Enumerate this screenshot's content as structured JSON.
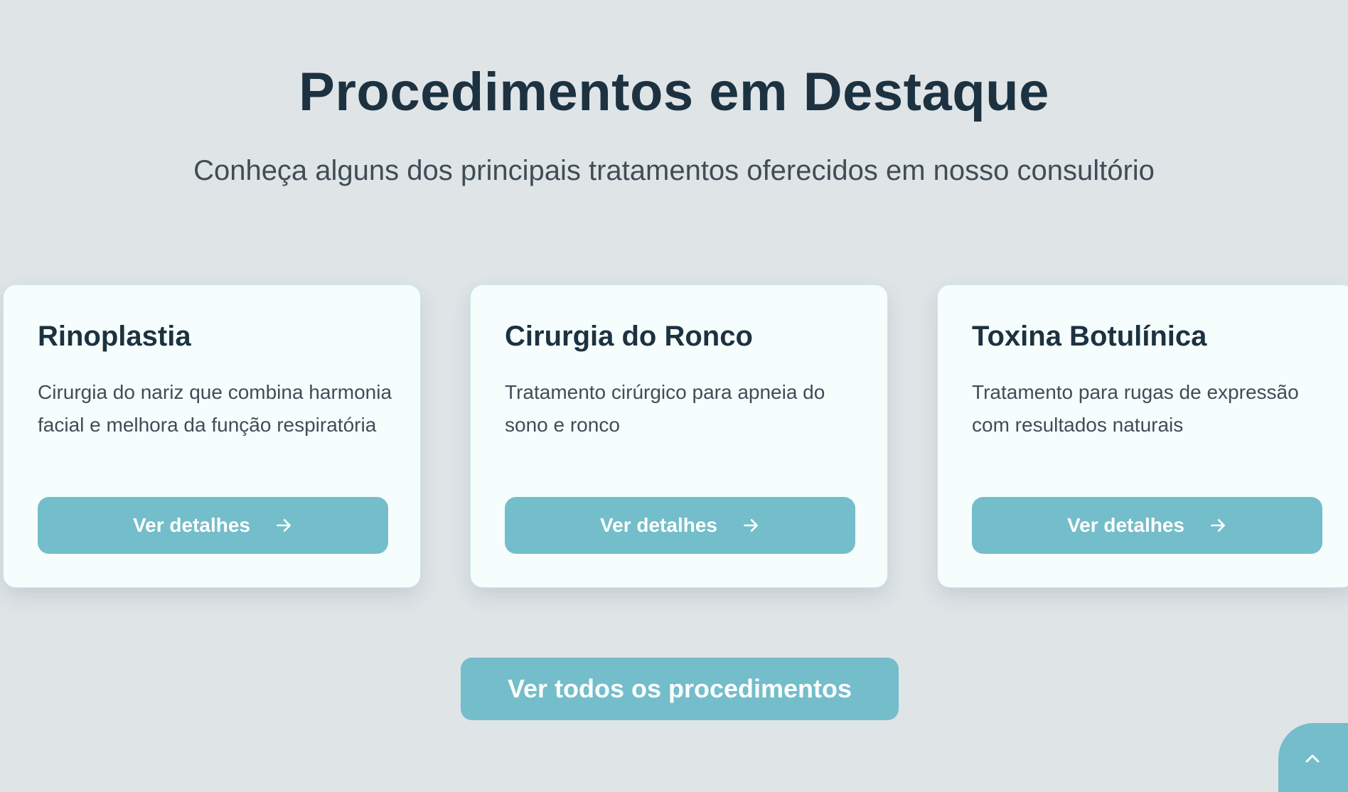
{
  "header": {
    "title": "Procedimentos em Destaque",
    "subtitle": "Conheça alguns dos principais tratamentos oferecidos em nosso consultório"
  },
  "cards": [
    {
      "title": "Rinoplastia",
      "description": "Cirurgia do nariz que combina harmonia facial e melhora da função respiratória",
      "button_label": "Ver detalhes"
    },
    {
      "title": "Cirurgia do Ronco",
      "description": "Tratamento cirúrgico para apneia do sono e ronco",
      "button_label": "Ver detalhes"
    },
    {
      "title": "Toxina Botulínica",
      "description": "Tratamento para rugas de expressão com resultados naturais",
      "button_label": "Ver detalhes"
    }
  ],
  "footer": {
    "all_button_label": "Ver todos os procedimentos"
  },
  "icons": {
    "card_button_icon": "arrow-right-icon",
    "scroll_top_icon": "chevron-up-icon"
  },
  "colors": {
    "background": "#dfe4e7",
    "card_background": "#f6fdfd",
    "accent": "#74bdca",
    "heading": "#1c3240",
    "body_text": "#3f4d56"
  }
}
